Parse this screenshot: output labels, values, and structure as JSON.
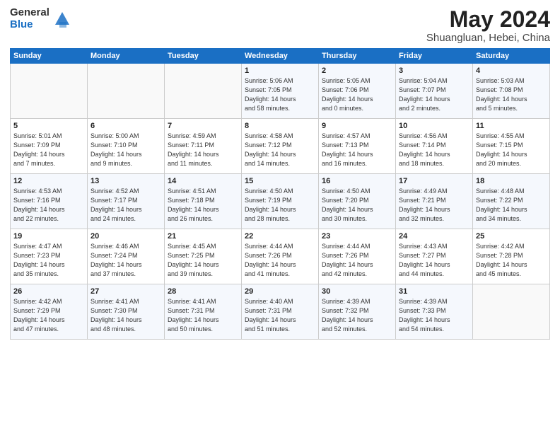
{
  "header": {
    "logo_general": "General",
    "logo_blue": "Blue",
    "month": "May 2024",
    "location": "Shuangluan, Hebei, China"
  },
  "days_of_week": [
    "Sunday",
    "Monday",
    "Tuesday",
    "Wednesday",
    "Thursday",
    "Friday",
    "Saturday"
  ],
  "weeks": [
    [
      {
        "day": "",
        "info": ""
      },
      {
        "day": "",
        "info": ""
      },
      {
        "day": "",
        "info": ""
      },
      {
        "day": "1",
        "info": "Sunrise: 5:06 AM\nSunset: 7:05 PM\nDaylight: 14 hours\nand 58 minutes."
      },
      {
        "day": "2",
        "info": "Sunrise: 5:05 AM\nSunset: 7:06 PM\nDaylight: 14 hours\nand 0 minutes."
      },
      {
        "day": "3",
        "info": "Sunrise: 5:04 AM\nSunset: 7:07 PM\nDaylight: 14 hours\nand 2 minutes."
      },
      {
        "day": "4",
        "info": "Sunrise: 5:03 AM\nSunset: 7:08 PM\nDaylight: 14 hours\nand 5 minutes."
      }
    ],
    [
      {
        "day": "5",
        "info": "Sunrise: 5:01 AM\nSunset: 7:09 PM\nDaylight: 14 hours\nand 7 minutes."
      },
      {
        "day": "6",
        "info": "Sunrise: 5:00 AM\nSunset: 7:10 PM\nDaylight: 14 hours\nand 9 minutes."
      },
      {
        "day": "7",
        "info": "Sunrise: 4:59 AM\nSunset: 7:11 PM\nDaylight: 14 hours\nand 11 minutes."
      },
      {
        "day": "8",
        "info": "Sunrise: 4:58 AM\nSunset: 7:12 PM\nDaylight: 14 hours\nand 14 minutes."
      },
      {
        "day": "9",
        "info": "Sunrise: 4:57 AM\nSunset: 7:13 PM\nDaylight: 14 hours\nand 16 minutes."
      },
      {
        "day": "10",
        "info": "Sunrise: 4:56 AM\nSunset: 7:14 PM\nDaylight: 14 hours\nand 18 minutes."
      },
      {
        "day": "11",
        "info": "Sunrise: 4:55 AM\nSunset: 7:15 PM\nDaylight: 14 hours\nand 20 minutes."
      }
    ],
    [
      {
        "day": "12",
        "info": "Sunrise: 4:53 AM\nSunset: 7:16 PM\nDaylight: 14 hours\nand 22 minutes."
      },
      {
        "day": "13",
        "info": "Sunrise: 4:52 AM\nSunset: 7:17 PM\nDaylight: 14 hours\nand 24 minutes."
      },
      {
        "day": "14",
        "info": "Sunrise: 4:51 AM\nSunset: 7:18 PM\nDaylight: 14 hours\nand 26 minutes."
      },
      {
        "day": "15",
        "info": "Sunrise: 4:50 AM\nSunset: 7:19 PM\nDaylight: 14 hours\nand 28 minutes."
      },
      {
        "day": "16",
        "info": "Sunrise: 4:50 AM\nSunset: 7:20 PM\nDaylight: 14 hours\nand 30 minutes."
      },
      {
        "day": "17",
        "info": "Sunrise: 4:49 AM\nSunset: 7:21 PM\nDaylight: 14 hours\nand 32 minutes."
      },
      {
        "day": "18",
        "info": "Sunrise: 4:48 AM\nSunset: 7:22 PM\nDaylight: 14 hours\nand 34 minutes."
      }
    ],
    [
      {
        "day": "19",
        "info": "Sunrise: 4:47 AM\nSunset: 7:23 PM\nDaylight: 14 hours\nand 35 minutes."
      },
      {
        "day": "20",
        "info": "Sunrise: 4:46 AM\nSunset: 7:24 PM\nDaylight: 14 hours\nand 37 minutes."
      },
      {
        "day": "21",
        "info": "Sunrise: 4:45 AM\nSunset: 7:25 PM\nDaylight: 14 hours\nand 39 minutes."
      },
      {
        "day": "22",
        "info": "Sunrise: 4:44 AM\nSunset: 7:26 PM\nDaylight: 14 hours\nand 41 minutes."
      },
      {
        "day": "23",
        "info": "Sunrise: 4:44 AM\nSunset: 7:26 PM\nDaylight: 14 hours\nand 42 minutes."
      },
      {
        "day": "24",
        "info": "Sunrise: 4:43 AM\nSunset: 7:27 PM\nDaylight: 14 hours\nand 44 minutes."
      },
      {
        "day": "25",
        "info": "Sunrise: 4:42 AM\nSunset: 7:28 PM\nDaylight: 14 hours\nand 45 minutes."
      }
    ],
    [
      {
        "day": "26",
        "info": "Sunrise: 4:42 AM\nSunset: 7:29 PM\nDaylight: 14 hours\nand 47 minutes."
      },
      {
        "day": "27",
        "info": "Sunrise: 4:41 AM\nSunset: 7:30 PM\nDaylight: 14 hours\nand 48 minutes."
      },
      {
        "day": "28",
        "info": "Sunrise: 4:41 AM\nSunset: 7:31 PM\nDaylight: 14 hours\nand 50 minutes."
      },
      {
        "day": "29",
        "info": "Sunrise: 4:40 AM\nSunset: 7:31 PM\nDaylight: 14 hours\nand 51 minutes."
      },
      {
        "day": "30",
        "info": "Sunrise: 4:39 AM\nSunset: 7:32 PM\nDaylight: 14 hours\nand 52 minutes."
      },
      {
        "day": "31",
        "info": "Sunrise: 4:39 AM\nSunset: 7:33 PM\nDaylight: 14 hours\nand 54 minutes."
      },
      {
        "day": "",
        "info": ""
      }
    ]
  ]
}
